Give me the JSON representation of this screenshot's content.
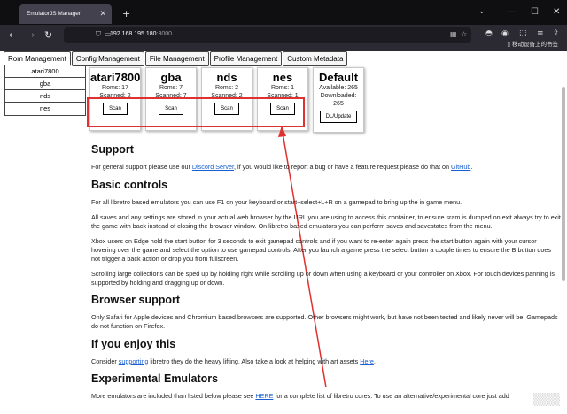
{
  "browser": {
    "tab_title": "EmulatorJS Manager",
    "tab_close": "✕",
    "new_tab": "+",
    "url_host": "192.168.195.180",
    "url_port": ":3000",
    "mobile_label": "移动设备上的书签",
    "minimize": "—",
    "maximize": "☐",
    "close": "✕",
    "chevron": "⌄"
  },
  "nav_tabs": [
    "Rom Management",
    "Config Management",
    "File Management",
    "Profile Management",
    "Custom Metadata"
  ],
  "systems_list": [
    "atari7800",
    "gba",
    "nds",
    "nes"
  ],
  "cards": [
    {
      "title": "atari7800",
      "line1": "Roms: 17",
      "line2": "Scanned: 2",
      "button": "Scan"
    },
    {
      "title": "gba",
      "line1": "Roms: 7",
      "line2": "Scanned: 7",
      "button": "Scan"
    },
    {
      "title": "nds",
      "line1": "Roms: 2",
      "line2": "Scanned: 2",
      "button": "Scan"
    },
    {
      "title": "nes",
      "line1": "Roms: 1",
      "line2": "Scanned: 1",
      "button": "Scan"
    },
    {
      "title": "Default",
      "line1": "Available: 265",
      "line2": "Downloaded:",
      "line3": "265",
      "button": "DL/Update"
    }
  ],
  "sections": {
    "support_h": "Support",
    "support_p1": "For general support please use our ",
    "support_link1": "Discord Server",
    "support_p2": ", if you would like to report a bug or have a feature request please do that on ",
    "support_link2": "GitHub",
    "support_p3": ".",
    "basic_h": "Basic controls",
    "basic_p1": "For all libretro based emulators you can use F1 on your keyboard or start+select+L+R on a gamepad to bring up the in game menu.",
    "basic_p2": "All saves and any settings are stored in your actual web browser by the URL you are using to access this container, to ensure sram is dumped on exit always try to exit the game with back instead of closing the browser window. On libretro based emulators you can perform saves and savestates from the menu.",
    "basic_p3": "Xbox users on Edge hold the start button for 3 seconds to exit gamepad controls and if you want to re-enter again press the start button again with your cursor hovering over the game and select the option to use gamepad controls. After you launch a game press the select button a couple times to ensure the B button does not trigger a back action or drop you from fullscreen.",
    "basic_p4": "Scrolling large collections can be sped up by holding right while scrolling up or down when using a keyboard or your controller on Xbox. For touch devices panning is supported by holding and dragging up or down.",
    "browser_h": "Browser support",
    "browser_p": "Only Safari for Apple devices and Chromium based browsers are supported. Other browsers might work, but have not been tested and likely never will be. Gamepads do not function on Firefox.",
    "enjoy_h": "If you enjoy this",
    "enjoy_p1": "Consider ",
    "enjoy_link1": "supporting",
    "enjoy_p2": " libretro they do the heavy lifting. Also take a look at helping with art assets ",
    "enjoy_link2": "Here",
    "enjoy_p3": ".",
    "exp_h": "Experimental Emulators",
    "exp_p1": "More emulators are included than listed below please see ",
    "exp_link": "HERE",
    "exp_p2": " for a complete list of libretro cores. To use an alternative/experimental core just add"
  },
  "colors": {
    "highlight": "#e03030",
    "link": "#1a5fd1"
  }
}
